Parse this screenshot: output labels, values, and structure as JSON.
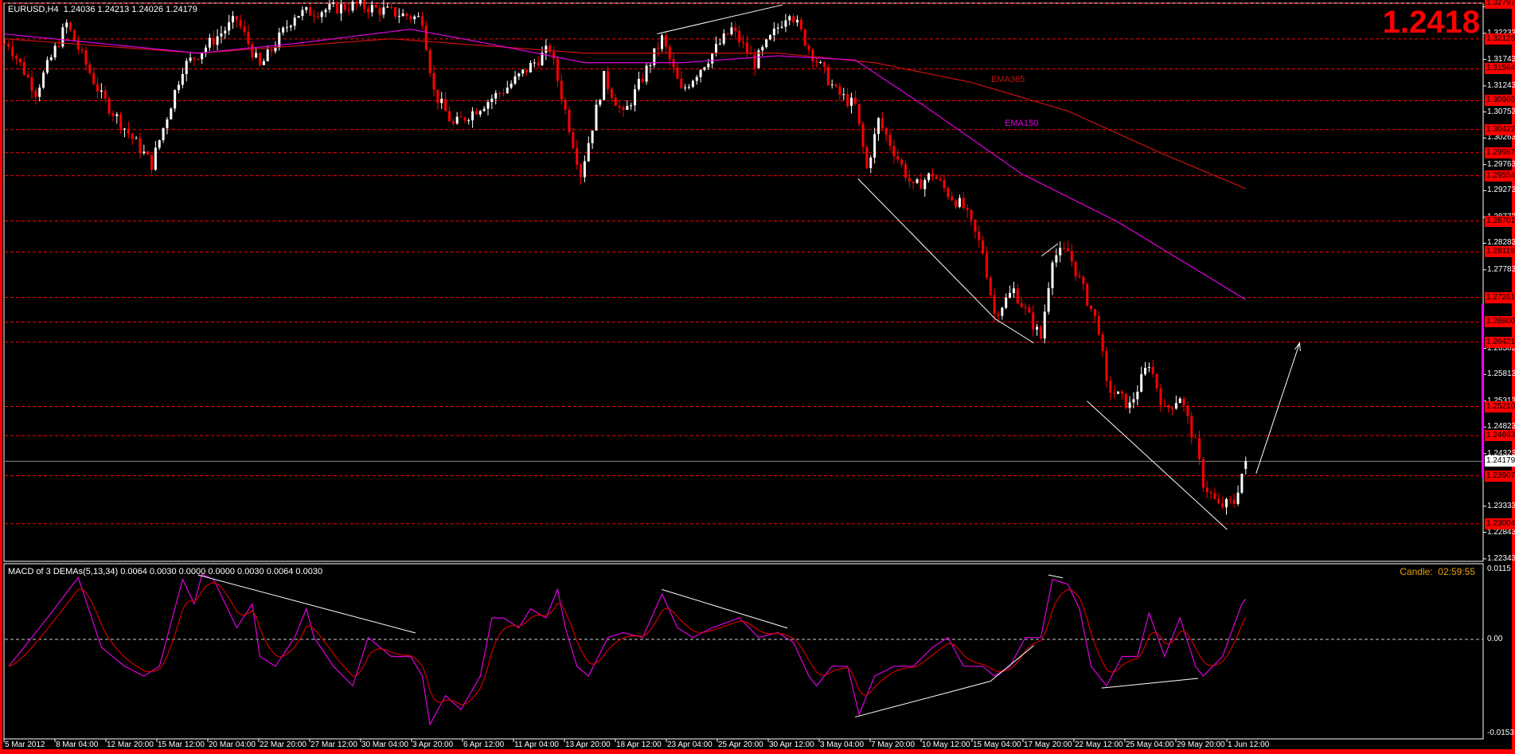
{
  "header": {
    "symbol": "EURUSD,H4",
    "ohlc": "1.24036 1.24213 1.24026 1.24179"
  },
  "big_price": "1.2418",
  "macd": {
    "label": "MACD of 3 DEMAs(5,13,34) 0.0064 0.0030 0.0000 0.0000 0.0030 0.0064 0.0030",
    "axis": [
      "0.0115",
      "0.00",
      "-0.0153"
    ],
    "candle_timer": "Candle:  02:59:55"
  },
  "ema_labels": {
    "ema365": "EMA365",
    "ema150": "EMA150"
  },
  "colors": {
    "bull": "#ffffff",
    "bear": "#ff0000",
    "ema150": "#e000e0",
    "ema365": "#cc1010",
    "level": "#ff0000",
    "timer": "#e8a000"
  },
  "price_axis": [
    "1.32733",
    "1.32233",
    "1.31743",
    "1.31243",
    "1.30753",
    "1.30263",
    "1.29763",
    "1.29273",
    "1.28773",
    "1.28283",
    "1.27783",
    "1.26303",
    "1.25813",
    "1.25313",
    "1.24823",
    "1.24323",
    "1.23333",
    "1.22843",
    "1.22343"
  ],
  "levels": [
    "1.32797",
    "1.32128",
    "1.31564",
    "1.30965",
    "1.30422",
    "1.29987",
    "1.29554",
    "1.28701",
    "1.28119",
    "1.27261",
    "1.26800",
    "1.26421",
    "1.25210",
    "1.24663",
    "1.23907",
    "1.23004"
  ],
  "current_price": "1.24179",
  "time_axis": [
    "5 Mar 2012",
    "8 Mar 04:00",
    "12 Mar 20:00",
    "15 Mar 12:00",
    "20 Mar 04:00",
    "22 Mar 20:00",
    "27 Mar 12:00",
    "30 Mar 04:00",
    "3 Apr 20:00",
    "6 Apr 12:00",
    "11 Apr 04:00",
    "13 Apr 20:00",
    "18 Apr 12:00",
    "23 Apr 04:00",
    "25 Apr 20:00",
    "30 Apr 12:00",
    "3 May 04:00",
    "7 May 20:00",
    "10 May 12:00",
    "15 May 04:00",
    "17 May 20:00",
    "22 May 12:00",
    "25 May 04:00",
    "29 May 20:00",
    "1 Jun 12:00"
  ],
  "chart_data": {
    "type": "candlestick",
    "title": "EURUSD,H4",
    "price_keypoints": [
      [
        1,
        1.3204
      ],
      [
        8,
        1.3113
      ],
      [
        16,
        1.3241
      ],
      [
        25,
        1.3104
      ],
      [
        38,
        1.2977
      ],
      [
        46,
        1.3159
      ],
      [
        60,
        1.325
      ],
      [
        66,
        1.3159
      ],
      [
        75,
        1.3259
      ],
      [
        91,
        1.3277
      ],
      [
        108,
        1.325
      ],
      [
        111,
        1.3113
      ],
      [
        116,
        1.305
      ],
      [
        130,
        1.3122
      ],
      [
        141,
        1.3195
      ],
      [
        149,
        1.2959
      ],
      [
        155,
        1.314
      ],
      [
        160,
        1.3068
      ],
      [
        170,
        1.3213
      ],
      [
        175,
        1.3113
      ],
      [
        188,
        1.3231
      ],
      [
        194,
        1.3168
      ],
      [
        203,
        1.3268
      ],
      [
        208,
        1.3195
      ],
      [
        215,
        1.3113
      ],
      [
        220,
        1.3086
      ],
      [
        223,
        1.2968
      ],
      [
        226,
        1.3059
      ],
      [
        235,
        1.2931
      ],
      [
        240,
        1.2959
      ],
      [
        244,
        1.2922
      ],
      [
        248,
        1.2895
      ],
      [
        253,
        1.2813
      ],
      [
        256,
        1.2695
      ],
      [
        261,
        1.274
      ],
      [
        268,
        1.265
      ],
      [
        271,
        1.2804
      ],
      [
        275,
        1.2813
      ],
      [
        279,
        1.274
      ],
      [
        283,
        1.2668
      ],
      [
        285,
        1.2559
      ],
      [
        291,
        1.2522
      ],
      [
        296,
        1.2604
      ],
      [
        300,
        1.2513
      ],
      [
        304,
        1.2541
      ],
      [
        308,
        1.245
      ],
      [
        310,
        1.2377
      ],
      [
        314,
        1.2332
      ],
      [
        318,
        1.2341
      ],
      [
        320,
        1.2395
      ],
      [
        321,
        1.2418
      ]
    ],
    "ema150": [
      [
        0,
        1.3222
      ],
      [
        25,
        1.3204
      ],
      [
        50,
        1.3186
      ],
      [
        75,
        1.3204
      ],
      [
        105,
        1.3231
      ],
      [
        125,
        1.3204
      ],
      [
        150,
        1.3168
      ],
      [
        175,
        1.3168
      ],
      [
        200,
        1.3181
      ],
      [
        220,
        1.3173
      ],
      [
        238,
        1.3086
      ],
      [
        263,
        1.2959
      ],
      [
        288,
        1.2868
      ],
      [
        321,
        1.2722
      ]
    ],
    "ema365": [
      [
        0,
        1.3213
      ],
      [
        50,
        1.3186
      ],
      [
        100,
        1.3213
      ],
      [
        150,
        1.3186
      ],
      [
        200,
        1.3186
      ],
      [
        225,
        1.3168
      ],
      [
        250,
        1.3131
      ],
      [
        275,
        1.3077
      ],
      [
        300,
        1.2995
      ],
      [
        321,
        1.2931
      ]
    ],
    "macd_main": [
      [
        1,
        -0.0044
      ],
      [
        5,
        -0.0013
      ],
      [
        11,
        0.0035
      ],
      [
        19,
        0.0101
      ],
      [
        25,
        -0.0013
      ],
      [
        31,
        -0.0044
      ],
      [
        36,
        -0.006
      ],
      [
        40,
        -0.0044
      ],
      [
        46,
        0.0098
      ],
      [
        49,
        0.0058
      ],
      [
        51,
        0.0106
      ],
      [
        54,
        0.0098
      ],
      [
        60,
        0.0019
      ],
      [
        64,
        0.0058
      ],
      [
        66,
        -0.0028
      ],
      [
        70,
        -0.0044
      ],
      [
        75,
        0.0003
      ],
      [
        78,
        0.005
      ],
      [
        80,
        0.0003
      ],
      [
        85,
        -0.0044
      ],
      [
        90,
        -0.0076
      ],
      [
        94,
        0.0003
      ],
      [
        100,
        -0.0028
      ],
      [
        105,
        -0.0028
      ],
      [
        108,
        -0.006
      ],
      [
        110,
        -0.0139
      ],
      [
        114,
        -0.0092
      ],
      [
        118,
        -0.0115
      ],
      [
        123,
        -0.006
      ],
      [
        126,
        0.0035
      ],
      [
        129,
        0.0035
      ],
      [
        133,
        0.0019
      ],
      [
        136,
        0.005
      ],
      [
        140,
        0.0035
      ],
      [
        143,
        0.0082
      ],
      [
        145,
        0.0019
      ],
      [
        148,
        -0.0044
      ],
      [
        151,
        -0.006
      ],
      [
        156,
        0.0003
      ],
      [
        160,
        0.0011
      ],
      [
        165,
        0.0003
      ],
      [
        170,
        0.0074
      ],
      [
        174,
        0.0019
      ],
      [
        178,
        0.0003
      ],
      [
        183,
        0.0019
      ],
      [
        190,
        0.0035
      ],
      [
        195,
        0.0003
      ],
      [
        200,
        0.0011
      ],
      [
        204,
        -0.0005
      ],
      [
        208,
        -0.006
      ],
      [
        210,
        -0.0076
      ],
      [
        214,
        -0.0044
      ],
      [
        218,
        -0.0044
      ],
      [
        221,
        -0.0123
      ],
      [
        225,
        -0.006
      ],
      [
        230,
        -0.0044
      ],
      [
        235,
        -0.0044
      ],
      [
        240,
        -0.0013
      ],
      [
        244,
        0.0003
      ],
      [
        248,
        -0.0044
      ],
      [
        253,
        -0.0044
      ],
      [
        256,
        -0.006
      ],
      [
        260,
        -0.0044
      ],
      [
        264,
        0.0003
      ],
      [
        268,
        0.0003
      ],
      [
        271,
        0.0098
      ],
      [
        275,
        0.009
      ],
      [
        278,
        0.005
      ],
      [
        281,
        -0.0044
      ],
      [
        285,
        -0.0076
      ],
      [
        289,
        -0.0028
      ],
      [
        293,
        -0.0028
      ],
      [
        296,
        0.0043
      ],
      [
        300,
        -0.0028
      ],
      [
        304,
        0.0035
      ],
      [
        308,
        -0.0044
      ],
      [
        310,
        -0.006
      ],
      [
        315,
        -0.0028
      ],
      [
        320,
        0.0058
      ],
      [
        321,
        0.0066
      ]
    ],
    "macd_range": [
      -0.0153,
      0.0115
    ],
    "ylim": [
      1.223,
      1.3286
    ]
  }
}
